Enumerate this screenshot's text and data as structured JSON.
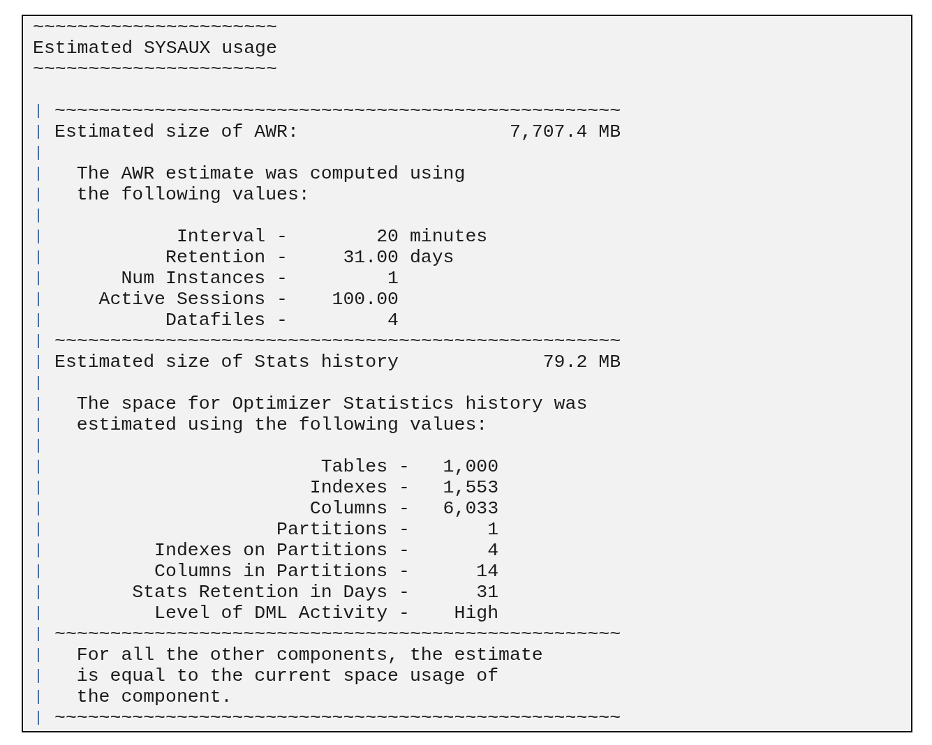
{
  "header_lines": [
    {
      "kind": "text",
      "text": "~~~~~~~~~~~~~~~~~~~~~~"
    },
    {
      "kind": "text",
      "text": "Estimated SYSAUX usage"
    },
    {
      "kind": "text",
      "text": "~~~~~~~~~~~~~~~~~~~~~~"
    },
    {
      "kind": "blank"
    }
  ],
  "report_lines": [
    {
      "kind": "text",
      "text": "~~~~~~~~~~~~~~~~~~~~~~~~~~~~~~~~~~~~~~~~~~~~~~~~~~~"
    },
    {
      "kind": "text",
      "text": "Estimated size of AWR:                   7,707.4 MB"
    },
    {
      "kind": "blank"
    },
    {
      "kind": "text",
      "text": "  The AWR estimate was computed using"
    },
    {
      "kind": "text",
      "text": "  the following values:"
    },
    {
      "kind": "blank"
    },
    {
      "kind": "text",
      "text": "           Interval -        20 minutes"
    },
    {
      "kind": "text",
      "text": "          Retention -     31.00 days"
    },
    {
      "kind": "text",
      "text": "      Num Instances -         1"
    },
    {
      "kind": "text",
      "text": "    Active Sessions -    100.00"
    },
    {
      "kind": "text",
      "text": "          Datafiles -         4"
    },
    {
      "kind": "text",
      "text": "~~~~~~~~~~~~~~~~~~~~~~~~~~~~~~~~~~~~~~~~~~~~~~~~~~~"
    },
    {
      "kind": "text",
      "text": "Estimated size of Stats history             79.2 MB"
    },
    {
      "kind": "blank"
    },
    {
      "kind": "text",
      "text": "  The space for Optimizer Statistics history was"
    },
    {
      "kind": "text",
      "text": "  estimated using the following values:"
    },
    {
      "kind": "blank"
    },
    {
      "kind": "text",
      "text": "                        Tables -   1,000"
    },
    {
      "kind": "text",
      "text": "                       Indexes -   1,553"
    },
    {
      "kind": "text",
      "text": "                       Columns -   6,033"
    },
    {
      "kind": "text",
      "text": "                    Partitions -       1"
    },
    {
      "kind": "text",
      "text": "         Indexes on Partitions -       4"
    },
    {
      "kind": "text",
      "text": "         Columns in Partitions -      14"
    },
    {
      "kind": "text",
      "text": "       Stats Retention in Days -      31"
    },
    {
      "kind": "text",
      "text": "         Level of DML Activity -    High"
    },
    {
      "kind": "text",
      "text": "~~~~~~~~~~~~~~~~~~~~~~~~~~~~~~~~~~~~~~~~~~~~~~~~~~~"
    },
    {
      "kind": "text",
      "text": "  For all the other components, the estimate"
    },
    {
      "kind": "text",
      "text": "  is equal to the current space usage of"
    },
    {
      "kind": "text",
      "text": "  the component."
    },
    {
      "kind": "text",
      "text": "~~~~~~~~~~~~~~~~~~~~~~~~~~~~~~~~~~~~~~~~~~~~~~~~~~~"
    }
  ]
}
